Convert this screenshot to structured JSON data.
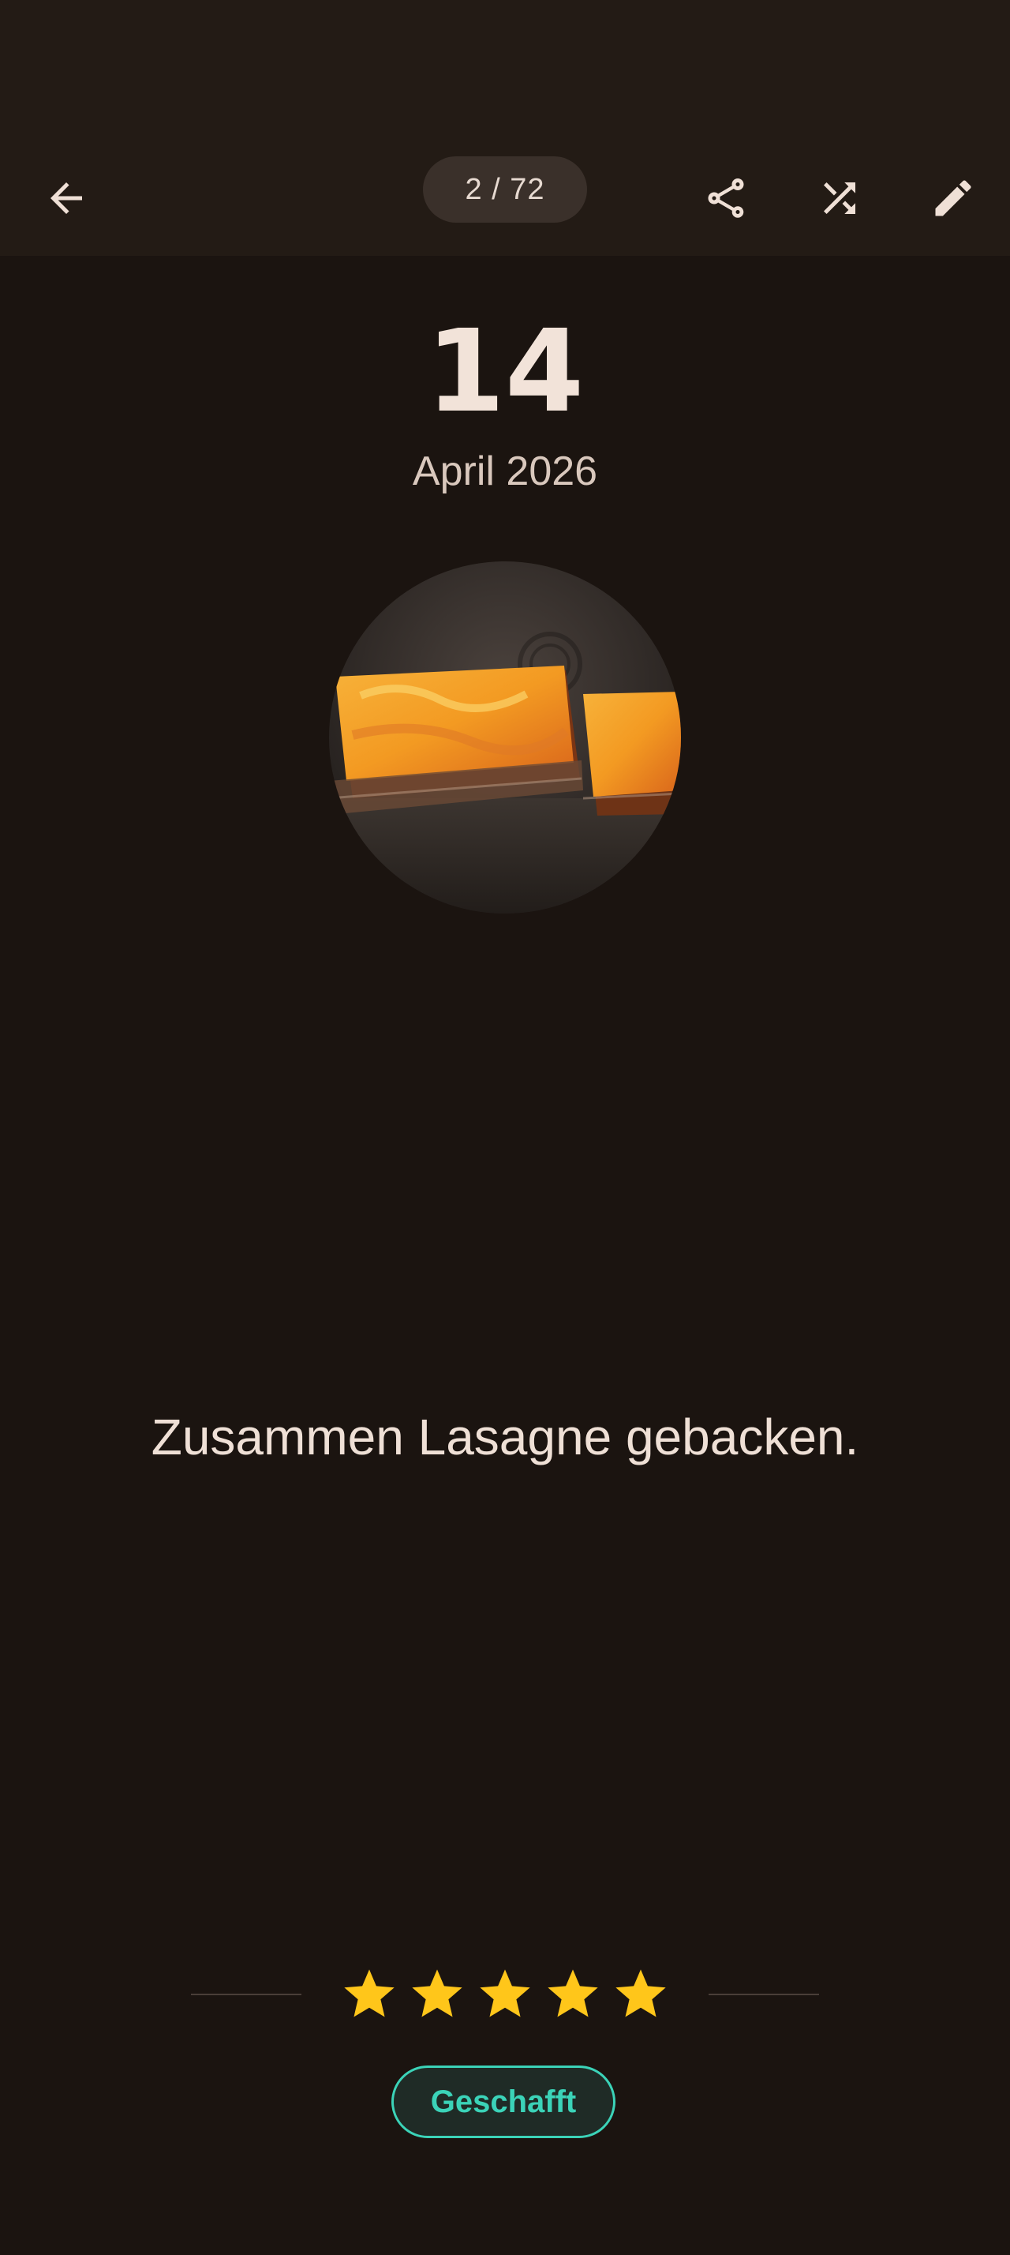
{
  "toolbar": {
    "counter": "2 / 72",
    "icons": [
      "arrow-back-icon",
      "share-icon",
      "shuffle-icon",
      "edit-icon"
    ]
  },
  "entry": {
    "day": "14",
    "month_year": "April 2026",
    "note": "Zusammen Lasagne gebacken.",
    "rating": 5,
    "rating_max": 5,
    "status": "Geschafft"
  },
  "colors": {
    "background": "#1b1410",
    "toolbar": "#231b15",
    "star": "#ffc61a",
    "status_accent": "#3bd3b8"
  }
}
